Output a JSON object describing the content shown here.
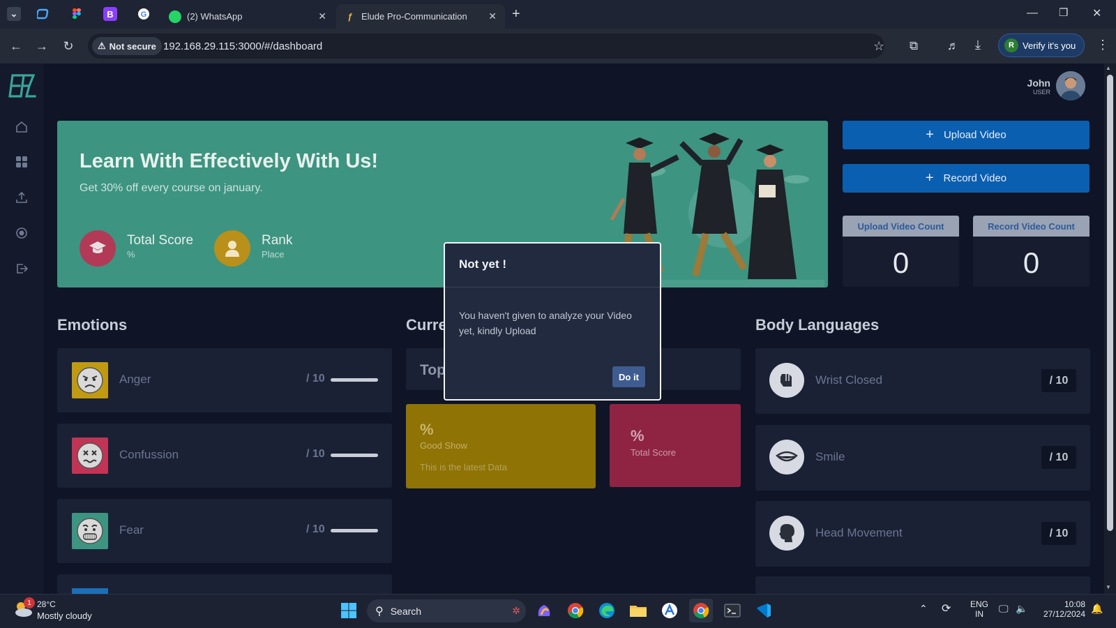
{
  "browser": {
    "tabs": [
      {
        "label": "(2) WhatsApp",
        "icon": "whatsapp-icon"
      },
      {
        "label": "Elude Pro-Communication",
        "icon": "elude-favicon",
        "active": true
      }
    ],
    "security_label": "Not secure",
    "url": "192.168.29.115:3000/#/dashboard",
    "profile_initial": "R",
    "verify_label": "Verify it's you"
  },
  "app": {
    "logo_text": "EPC",
    "user": {
      "name": "John",
      "role": "USER"
    },
    "banner": {
      "title": "Learn With Effectively With Us!",
      "subtitle": "Get 30% off every course on january.",
      "stats": [
        {
          "title": "Total Score",
          "sub": "%",
          "icon": "graduation-cap-icon",
          "color": "#b23a56"
        },
        {
          "title": "Rank",
          "sub": "Place",
          "icon": "person-icon",
          "color": "#b8901a"
        }
      ]
    },
    "actions": {
      "upload_label": "Upload Video",
      "record_label": "Record Video"
    },
    "counts": [
      {
        "label": "Upload Video Count",
        "value": "0"
      },
      {
        "label": "Record Video Count",
        "value": "0"
      }
    ],
    "sections": {
      "emotions": "Emotions",
      "current": "Curre",
      "body": "Body Languages"
    },
    "emotions": [
      {
        "label": "Anger",
        "score": "/ 10",
        "color": "#c09a12",
        "icon": "angry-face-icon"
      },
      {
        "label": "Confussion",
        "score": "/ 10",
        "color": "#c23455",
        "icon": "confused-face-icon"
      },
      {
        "label": "Fear",
        "score": "/ 10",
        "color": "#3d9481",
        "icon": "fearful-face-icon"
      }
    ],
    "current": {
      "top_label": "Top",
      "cards": [
        {
          "value": "%",
          "title": "Good Show",
          "note": "This is the latest Data",
          "color": "#8f7305"
        },
        {
          "value": "%",
          "title": "Total Score",
          "note": "",
          "color": "#8f2442"
        }
      ]
    },
    "body_languages": [
      {
        "label": "Wrist Closed",
        "score": "/ 10",
        "icon": "fist-icon"
      },
      {
        "label": "Smile",
        "score": "/ 10",
        "icon": "lips-icon"
      },
      {
        "label": "Head Movement",
        "score": "/ 10",
        "icon": "head-icon"
      }
    ]
  },
  "modal": {
    "title": "Not yet !",
    "body": "You haven't given to analyze your Video yet, kindly Upload",
    "button": "Do it"
  },
  "taskbar": {
    "weather_temp": "28°C",
    "weather_desc": "Mostly cloudy",
    "weather_badge": "1",
    "search_label": "Search",
    "lang_top": "ENG",
    "lang_bottom": "IN",
    "time": "10:08",
    "date": "27/12/2024"
  }
}
